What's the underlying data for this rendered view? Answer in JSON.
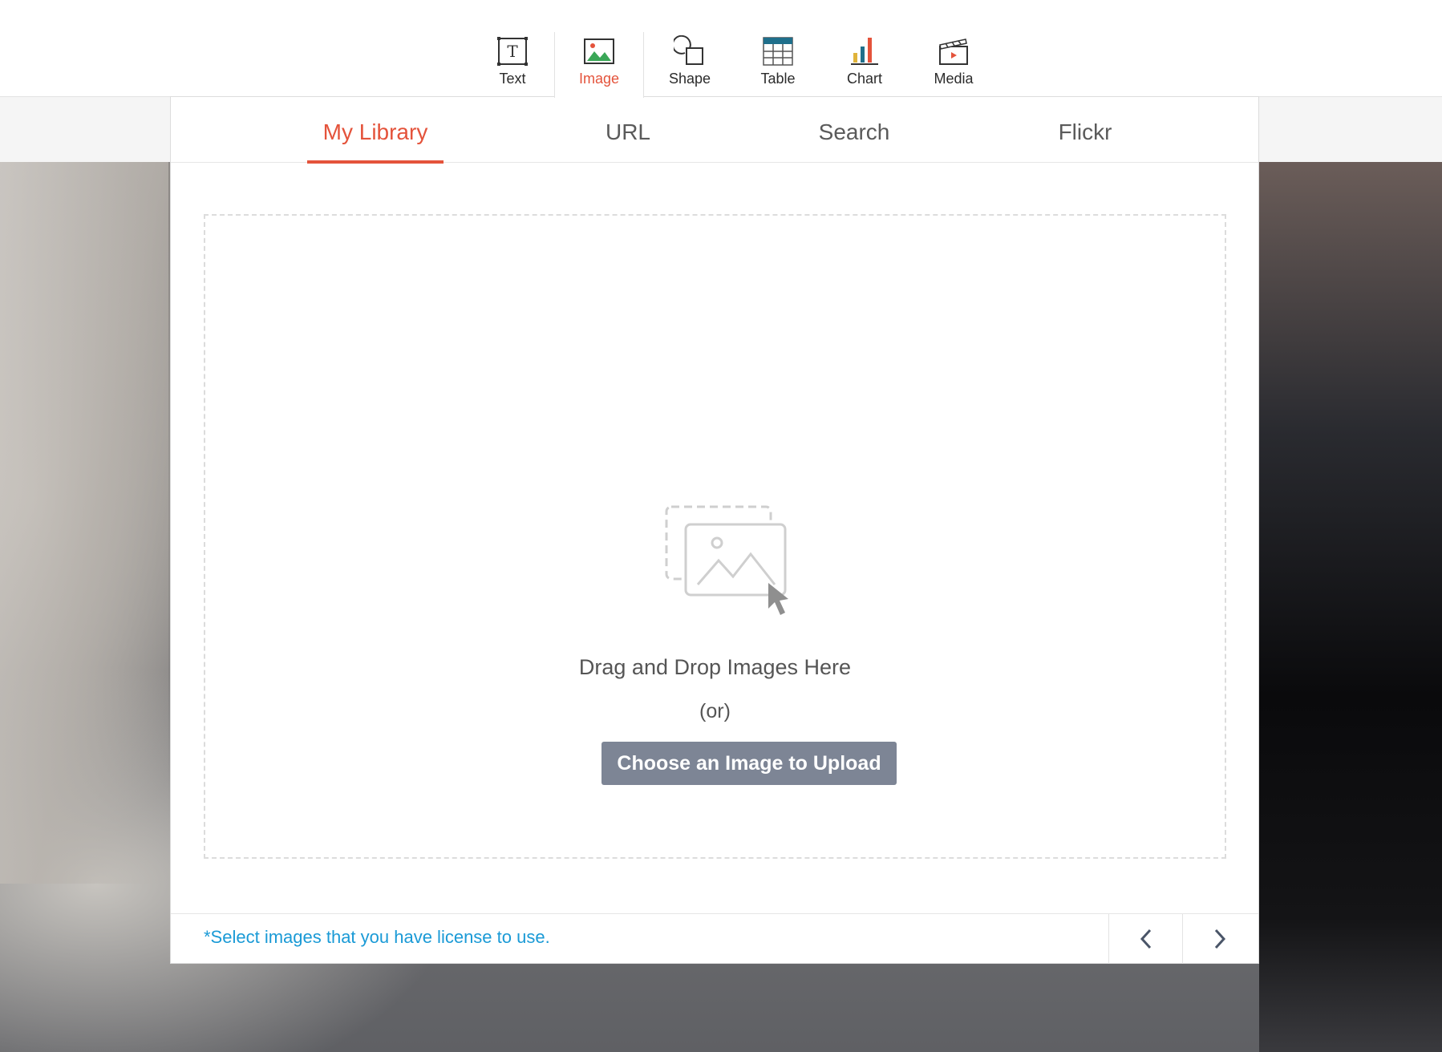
{
  "toolbar": {
    "items": [
      {
        "label": "Text",
        "icon": "text-icon"
      },
      {
        "label": "Image",
        "icon": "image-icon",
        "active": true
      },
      {
        "label": "Shape",
        "icon": "shape-icon"
      },
      {
        "label": "Table",
        "icon": "table-icon"
      },
      {
        "label": "Chart",
        "icon": "chart-icon"
      },
      {
        "label": "Media",
        "icon": "media-icon"
      }
    ],
    "active_color": "#e4533b"
  },
  "dialog": {
    "tabs": [
      {
        "label": "My Library",
        "active": true
      },
      {
        "label": "URL"
      },
      {
        "label": "Search"
      },
      {
        "label": "Flickr"
      }
    ],
    "dropzone": {
      "title": "Drag and Drop Images Here",
      "or": "(or)",
      "upload_label": "Choose an Image to Upload",
      "icon": "image-upload-icon"
    },
    "footer": {
      "license_note": "*Select images that you have license to use.",
      "prev_icon": "chevron-left-icon",
      "next_icon": "chevron-right-icon"
    }
  },
  "colors": {
    "accent": "#e4533b",
    "link": "#1a9ad6",
    "button": "#7d8595"
  }
}
